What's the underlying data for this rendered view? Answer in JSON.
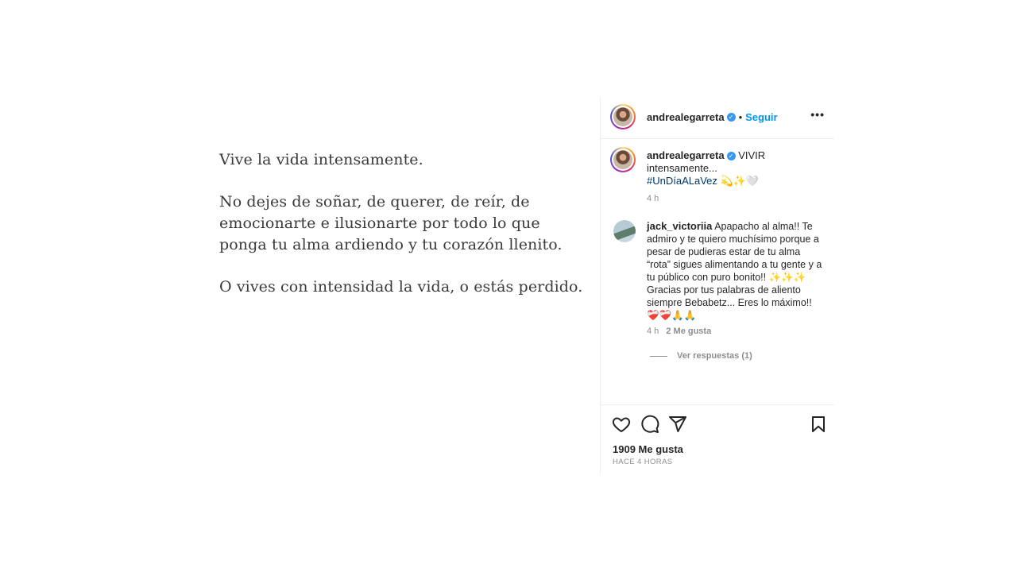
{
  "post_text": {
    "p1": "Vive la vida intensamente.",
    "p2": "No dejes de soñar, de querer, de reír, de\nemocionarte e ilusionarte por todo lo que\nponga tu alma ardiendo y tu corazón llenito.",
    "p3": "O vives con intensidad la vida, o estás perdido."
  },
  "header": {
    "username": "andrealegarreta",
    "verified_icon": "✓",
    "separator": "•",
    "follow_label": "Seguir",
    "more_icon": "•••"
  },
  "caption": {
    "username": "andrealegarreta",
    "text_1": "VIVIR",
    "text_2": "intensamente...",
    "hashtag": "#UnDíaALaVez",
    "emojis": "💫✨🤍",
    "time": "4 h"
  },
  "comment": {
    "username": "jack_victoriia",
    "text": "Apapacho al alma!! Te admiro y te quiero muchísimo porque a pesar de pudieras estar de tu alma “rota” sigues alimentando a tu gente y a tu público con puro bonito!! ✨✨✨ Gracias por tus palabras de aliento siempre Bebabetz... Eres lo máximo!! ❤️‍🩹❤️‍🩹🙏🙏",
    "time": "4 h",
    "likes": "2 Me gusta",
    "view_replies": "Ver respuestas (1)"
  },
  "actions": {
    "icons": [
      "heart-icon",
      "comment-icon",
      "share-icon",
      "bookmark-icon"
    ]
  },
  "footer": {
    "likes": "1909 Me gusta",
    "time_ago": "HACE 4 HORAS"
  },
  "colors": {
    "follow": "#0095f6",
    "hashtag": "#00376b",
    "verified": "#3897f0",
    "muted": "#8e8e8e"
  }
}
